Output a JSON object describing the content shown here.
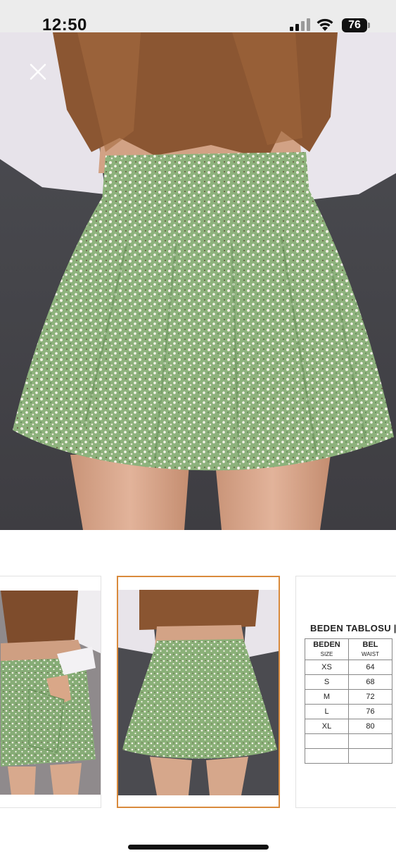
{
  "status_bar": {
    "time": "12:50",
    "battery": "76"
  },
  "main_image": {
    "alt": "",
    "colors": {
      "skirt": "#8fb27f",
      "blouse": "#e6e2e8",
      "hair": "#8a5530",
      "background": "#4a4a4e"
    }
  },
  "thumbnails": [
    {
      "id": "thumb-1",
      "selected": false
    },
    {
      "id": "thumb-2",
      "selected": true
    },
    {
      "id": "thumb-3",
      "selected": false
    }
  ],
  "size_chart": {
    "title": "BEDEN TABLOSU | S",
    "headers": [
      {
        "label": "BEDEN",
        "sub": "SIZE"
      },
      {
        "label": "BEL",
        "sub": "WAIST"
      }
    ],
    "rows": [
      [
        "XS",
        "64"
      ],
      [
        "S",
        "68"
      ],
      [
        "M",
        "72"
      ],
      [
        "L",
        "76"
      ],
      [
        "XL",
        "80"
      ],
      [
        "",
        ""
      ],
      [
        "",
        ""
      ]
    ]
  },
  "accent_color": "#d98a3c"
}
